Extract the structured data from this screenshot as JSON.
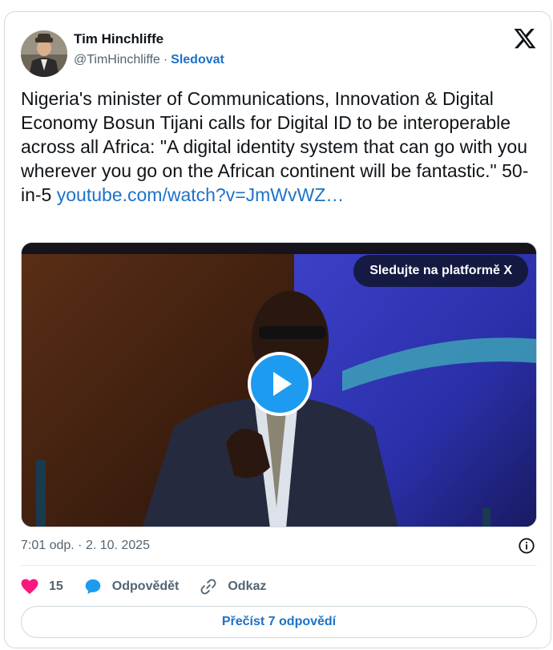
{
  "author": {
    "name": "Tim Hinchliffe",
    "handle": "@TimHinchliffe",
    "separator": "·",
    "follow_label": "Sledovat"
  },
  "tweet": {
    "text": "Nigeria's minister of Communications, Innovation & Digital Economy Bosun Tijani calls for Digital ID to be interoperable across all Africa: \"A digital identity system that can go with you wherever you go on the African continent will be fantastic.\" 50-in-5 ",
    "link_text": "youtube.com/watch?v=JmWvWZ…"
  },
  "media": {
    "watch_on_x_label": "Sledujte na platformě X",
    "play_icon": "play-icon"
  },
  "meta": {
    "timestamp": "7:01 odp. · 2. 10. 2025",
    "info_icon": "info-icon"
  },
  "actions": {
    "like_count": "15",
    "reply_label": "Odpovědět",
    "link_label": "Odkaz"
  },
  "read_replies_label": "Přečíst 7 odpovědí",
  "colors": {
    "link_blue": "#1d72c8",
    "play_blue": "#1d9bf0",
    "like_pink": "#f91880",
    "muted": "#536471",
    "border": "#cfd9de"
  }
}
